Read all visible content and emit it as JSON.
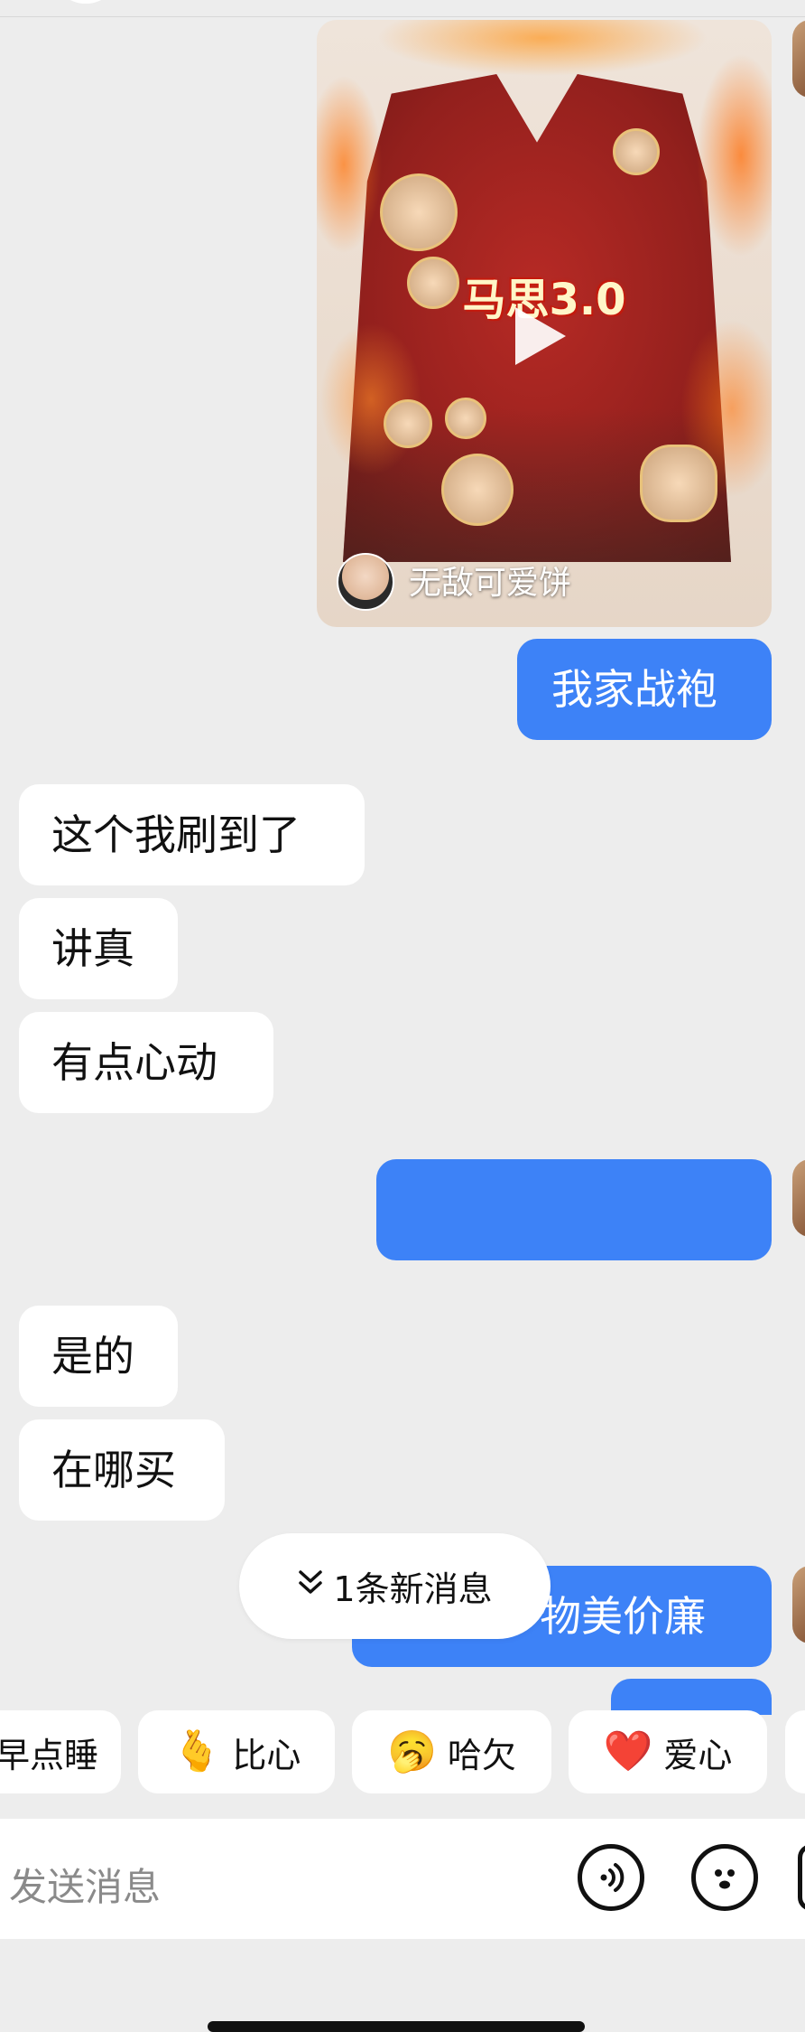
{
  "video_card": {
    "overlay_text": "马思3.0",
    "author_name": "无敌可爱饼"
  },
  "messages": [
    {
      "side": "right",
      "text": "我家战袍"
    },
    {
      "side": "left",
      "text": "这个我刷到了"
    },
    {
      "side": "left",
      "text": "讲真"
    },
    {
      "side": "left",
      "text": "有点心动"
    },
    {
      "side": "right",
      "text": "",
      "blurred": true
    },
    {
      "side": "left",
      "text": "是的"
    },
    {
      "side": "left",
      "text": "在哪买"
    },
    {
      "side": "right",
      "text": "物美价廉"
    }
  ],
  "new_message_pill": {
    "icon": "double-chevron-down-icon",
    "label": "1条新消息"
  },
  "quick_replies": [
    {
      "emoji": "",
      "label": "早点睡",
      "icon": "sleep-emoji"
    },
    {
      "emoji": "🫰",
      "label": "比心",
      "icon": "finger-heart-emoji"
    },
    {
      "emoji": "🥱",
      "label": "哈欠",
      "icon": "yawn-emoji"
    },
    {
      "emoji": "❤️",
      "label": "爱心",
      "icon": "heart-emoji"
    }
  ],
  "input_bar": {
    "placeholder": "发送消息",
    "voice_icon": "voice-icon",
    "emoji_icon": "emoji-face-icon"
  }
}
